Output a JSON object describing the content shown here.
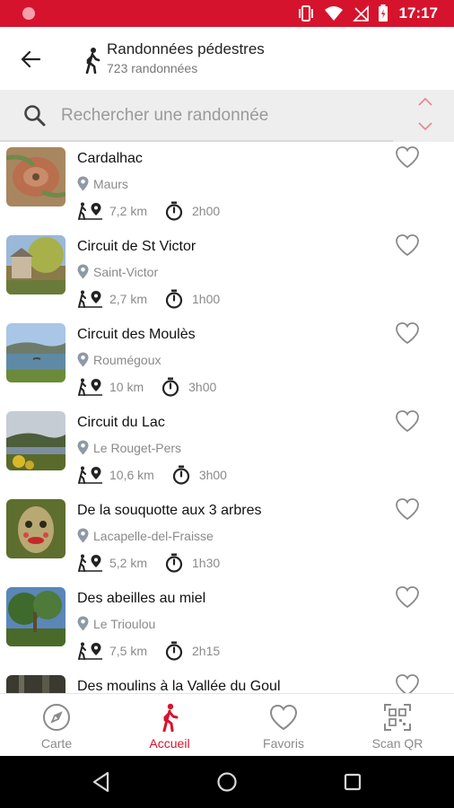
{
  "status_bar": {
    "time": "17:17"
  },
  "header": {
    "title": "Randonnées pédestres",
    "subtitle": "723 randonnées"
  },
  "search": {
    "placeholder": "Rechercher une randonnée",
    "value": ""
  },
  "hikes": [
    {
      "name": "Cardalhac",
      "location": "Maurs",
      "distance": "7,2 km",
      "duration": "2h00",
      "favorite": false
    },
    {
      "name": "Circuit de St Victor",
      "location": "Saint-Victor",
      "distance": "2,7 km",
      "duration": "1h00",
      "favorite": false
    },
    {
      "name": "Circuit des Moulès",
      "location": "Roumégoux",
      "distance": "10 km",
      "duration": "3h00",
      "favorite": false
    },
    {
      "name": "Circuit du Lac",
      "location": "Le Rouget-Pers",
      "distance": "10,6 km",
      "duration": "3h00",
      "favorite": false
    },
    {
      "name": "De la souquotte aux 3 arbres",
      "location": "Lacapelle-del-Fraisse",
      "distance": "5,2 km",
      "duration": "1h30",
      "favorite": false
    },
    {
      "name": "Des abeilles au miel",
      "location": "Le Trioulou",
      "distance": "7,5 km",
      "duration": "2h15",
      "favorite": false
    },
    {
      "name": "Des moulins à la Vallée du Goul",
      "location": "",
      "distance": "",
      "duration": "",
      "favorite": false
    }
  ],
  "bottom_nav": {
    "items": [
      {
        "label": "Carte",
        "icon": "compass-icon",
        "active": false
      },
      {
        "label": "Accueil",
        "icon": "hiker-icon",
        "active": true
      },
      {
        "label": "Favoris",
        "icon": "heart-icon",
        "active": false
      },
      {
        "label": "Scan QR",
        "icon": "qr-code-icon",
        "active": false
      }
    ]
  },
  "colors": {
    "accent": "#d6132d",
    "muted": "#8a8a8a",
    "search_bg": "#eeeeee"
  }
}
